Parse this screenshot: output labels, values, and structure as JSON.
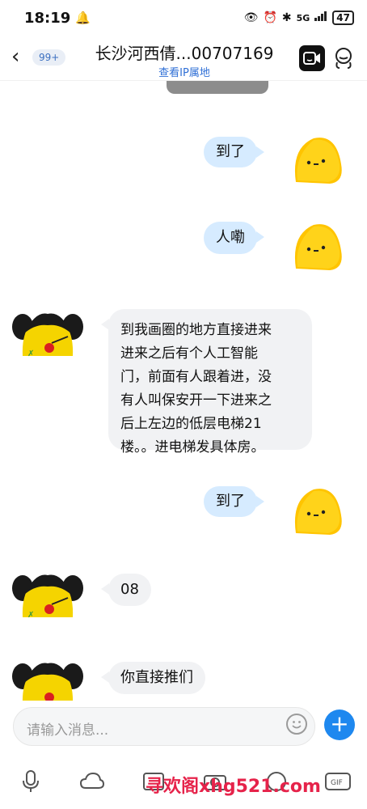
{
  "status": {
    "time": "18:19",
    "battery": "47",
    "network": "5G"
  },
  "header": {
    "back_badge": "99+",
    "title": "长沙河西倩...00707169",
    "subtitle": "查看IP属地"
  },
  "messages": [
    {
      "side": "right",
      "text": "到了"
    },
    {
      "side": "right",
      "text": "人嘞"
    },
    {
      "side": "left",
      "lines": [
        "到我画圈的地方直接进来",
        "进来之后有个人工智能",
        "门，前面有人跟着进，没",
        "有人叫保安开一下进来之",
        "后上左边的低层电梯21",
        "楼。。进电梯发具体房。"
      ]
    },
    {
      "side": "right",
      "text": "到了"
    },
    {
      "side": "left",
      "text": "08"
    },
    {
      "side": "left",
      "text": "你直接推们"
    }
  ],
  "input": {
    "placeholder": "请输入消息..."
  },
  "toolbar": [
    "mic-icon",
    "cloud-icon",
    "image-icon",
    "camera-icon",
    "redpacket-icon",
    "gif-icon"
  ],
  "watermark": "寻欢阁xhg521.com",
  "colors": {
    "accent": "#1e88ef",
    "bubble_right": "#d6ebff",
    "bubble_left": "#f1f2f4"
  }
}
